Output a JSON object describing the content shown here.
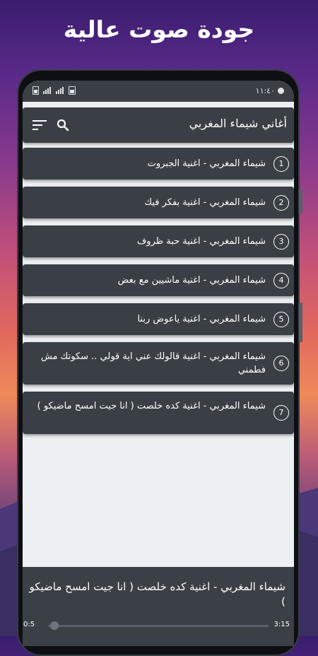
{
  "headline": "جودة صوت عالية",
  "status_bar": {
    "time": "١١:٤٠",
    "icons": [
      "battery-icon",
      "signal-icon",
      "signal-icon",
      "sim-icon",
      "alarm-icon"
    ]
  },
  "toolbar": {
    "title": "أغاني شيماء المغربي",
    "icons": [
      "sort-icon",
      "search-icon"
    ]
  },
  "songs": [
    {
      "num": "1",
      "title": "شيماء المغربي - اغنية الجبروت"
    },
    {
      "num": "2",
      "title": "شيماء المغربي - اغنية بفكر فيك"
    },
    {
      "num": "3",
      "title": "شيماء المغربي - اغنية حبة ظروف"
    },
    {
      "num": "4",
      "title": "شيماء المغربي - اغنية ماشيين مع بعض"
    },
    {
      "num": "5",
      "title": "شيماء المغربي - اغنية ياعوض ربنا"
    },
    {
      "num": "6",
      "title": "شيماء المغربي - اغنية قالولك عني اية قولي .. سكوتك مش فطمني"
    },
    {
      "num": "7",
      "title": "شيماء المغربي - اغنية كده خلصت ( انا جيت امسح ماضيكو )"
    }
  ],
  "player": {
    "title": "شيماء المغربي - اغنية كده خلصت ( انا جيت امسح ماضيكو )",
    "current_time": "0:5",
    "total_time": "3:15",
    "progress": 0.03
  },
  "colors": {
    "bar_bg": "#393f45",
    "list_bg": "#edf0f3",
    "text": "#ffffff"
  }
}
